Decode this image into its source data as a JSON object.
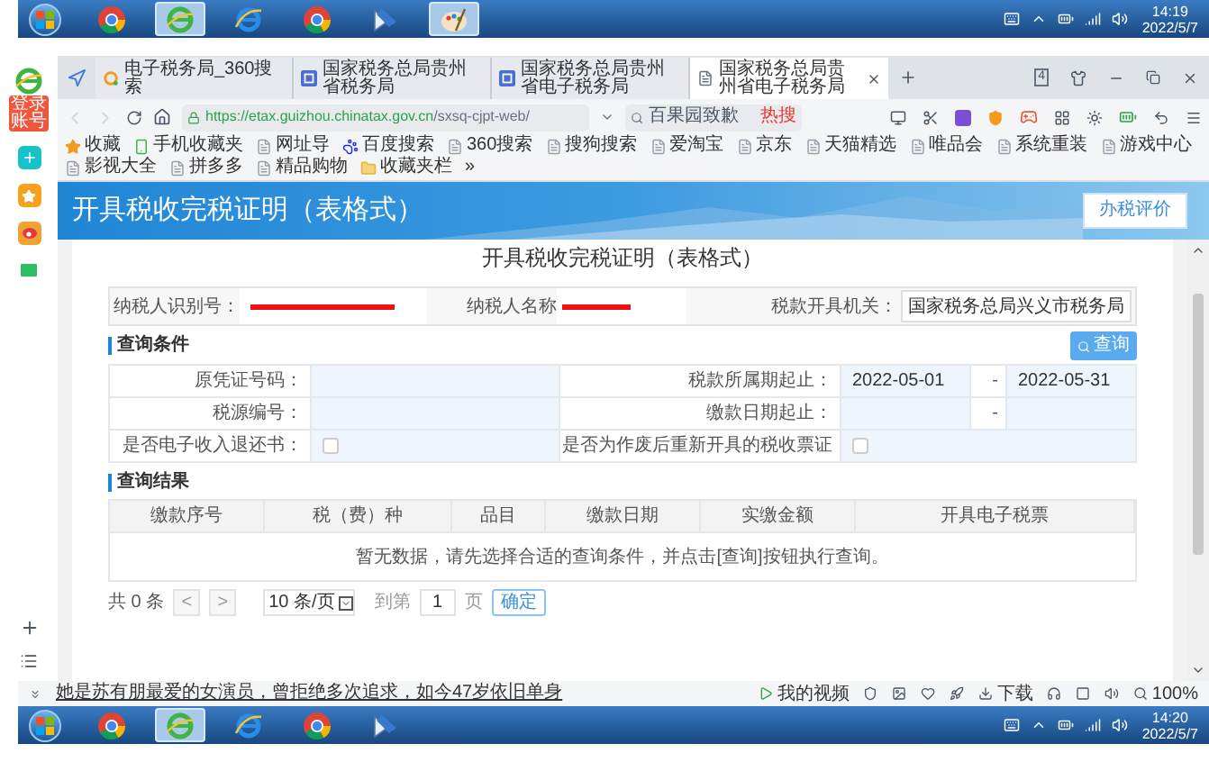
{
  "taskbar_top": {
    "time": "14:19",
    "date": "2022/5/7",
    "apps": [
      {
        "kind": "chrome",
        "selected": false
      },
      {
        "kind": "browser360",
        "selected": true
      },
      {
        "kind": "ie",
        "selected": false
      },
      {
        "kind": "chrome",
        "selected": false
      },
      {
        "kind": "scanner",
        "selected": false
      },
      {
        "kind": "paint",
        "selected": true
      }
    ]
  },
  "sidebar": {
    "login_badge": "登录账号"
  },
  "browser": {
    "tabs": [
      {
        "kind": "search",
        "title": "电子税务局_360搜索",
        "selected": false
      },
      {
        "kind": "site",
        "title": "国家税务总局贵州省税务局",
        "selected": false
      },
      {
        "kind": "site",
        "title": "国家税务总局贵州省电子税务局",
        "selected": false
      },
      {
        "kind": "page",
        "title": "国家税务总局贵州省电子税务局",
        "selected": true
      }
    ],
    "tab_count": "4",
    "address": {
      "host": "https://etax.guizhou.chinatax.gov.cn",
      "path": "/sxsq-cjpt-web/"
    },
    "search": {
      "value": "百果园致歉",
      "hot_badge": "热搜"
    },
    "bookmarks": [
      {
        "kind": "star",
        "label": "收藏"
      },
      {
        "kind": "phone",
        "label": "手机收藏夹"
      },
      {
        "kind": "page",
        "label": "网址导"
      },
      {
        "kind": "paw",
        "label": "百度搜索"
      },
      {
        "kind": "page",
        "label": "360搜索"
      },
      {
        "kind": "page",
        "label": "搜狗搜索"
      },
      {
        "kind": "page",
        "label": "爱淘宝"
      },
      {
        "kind": "page",
        "label": "京东"
      },
      {
        "kind": "page",
        "label": "天猫精选"
      },
      {
        "kind": "page",
        "label": "唯品会"
      },
      {
        "kind": "page",
        "label": "系统重装"
      },
      {
        "kind": "page",
        "label": "游戏中心"
      },
      {
        "kind": "page",
        "label": "影视大全"
      },
      {
        "kind": "page",
        "label": "拼多多"
      },
      {
        "kind": "page",
        "label": "精品购物"
      },
      {
        "kind": "folder",
        "label": "收藏夹栏"
      },
      {
        "kind": "more",
        "label": "»"
      }
    ]
  },
  "page": {
    "header_title": "开具税收完税证明（表格式）",
    "rating_button": "办税评价",
    "panel_title": "开具税收完税证明（表格式）",
    "taxpayer": {
      "id_label": "纳税人识别号：",
      "name_label": "纳税人名称",
      "authority_label": "税款开具机关：",
      "authority_value": "国家税务总局兴义市税务局"
    },
    "query": {
      "title": "查询条件",
      "button": "查询",
      "voucher_label": "原凭证号码：",
      "period_label": "税款所属期起止：",
      "period_from": "2022-05-01",
      "period_sep": "-",
      "period_to": "2022-05-31",
      "source_label": "税源编号：",
      "paydate_label": "缴款日期起止：",
      "paydate_sep": "-",
      "checks": [
        {
          "label": "是否电子收入退还书：",
          "checked": false
        },
        {
          "label": "是否为作废后重新开具的税收票证",
          "checked": false
        }
      ]
    },
    "results": {
      "title": "查询结果",
      "columns": [
        "缴款序号",
        "税（费）种",
        "品目",
        "缴款日期",
        "实缴金额",
        "开具电子税票"
      ],
      "empty_message": "暂无数据，请先选择合适的查询条件，并点击[查询]按钮执行查询。"
    },
    "pagination": {
      "total": "共 0 条",
      "prev": "<",
      "next": ">",
      "page_size": "10 条/页",
      "goto_label": "到第",
      "goto_value": "1",
      "page_unit": "页",
      "confirm": "确定"
    }
  },
  "status_bar": {
    "news": "她是苏有朋最爱的女演员，曾拒绝多次追求，如今47岁依旧单身",
    "video": "我的视频",
    "download": "下载",
    "zoom": "100%"
  },
  "taskbar_bottom": {
    "time": "14:20",
    "date": "2022/5/7",
    "apps": [
      {
        "kind": "chrome",
        "selected": false
      },
      {
        "kind": "browser360",
        "selected": true
      },
      {
        "kind": "ie",
        "selected": false
      },
      {
        "kind": "chrome",
        "selected": false
      },
      {
        "kind": "scanner",
        "selected": false
      }
    ]
  }
}
